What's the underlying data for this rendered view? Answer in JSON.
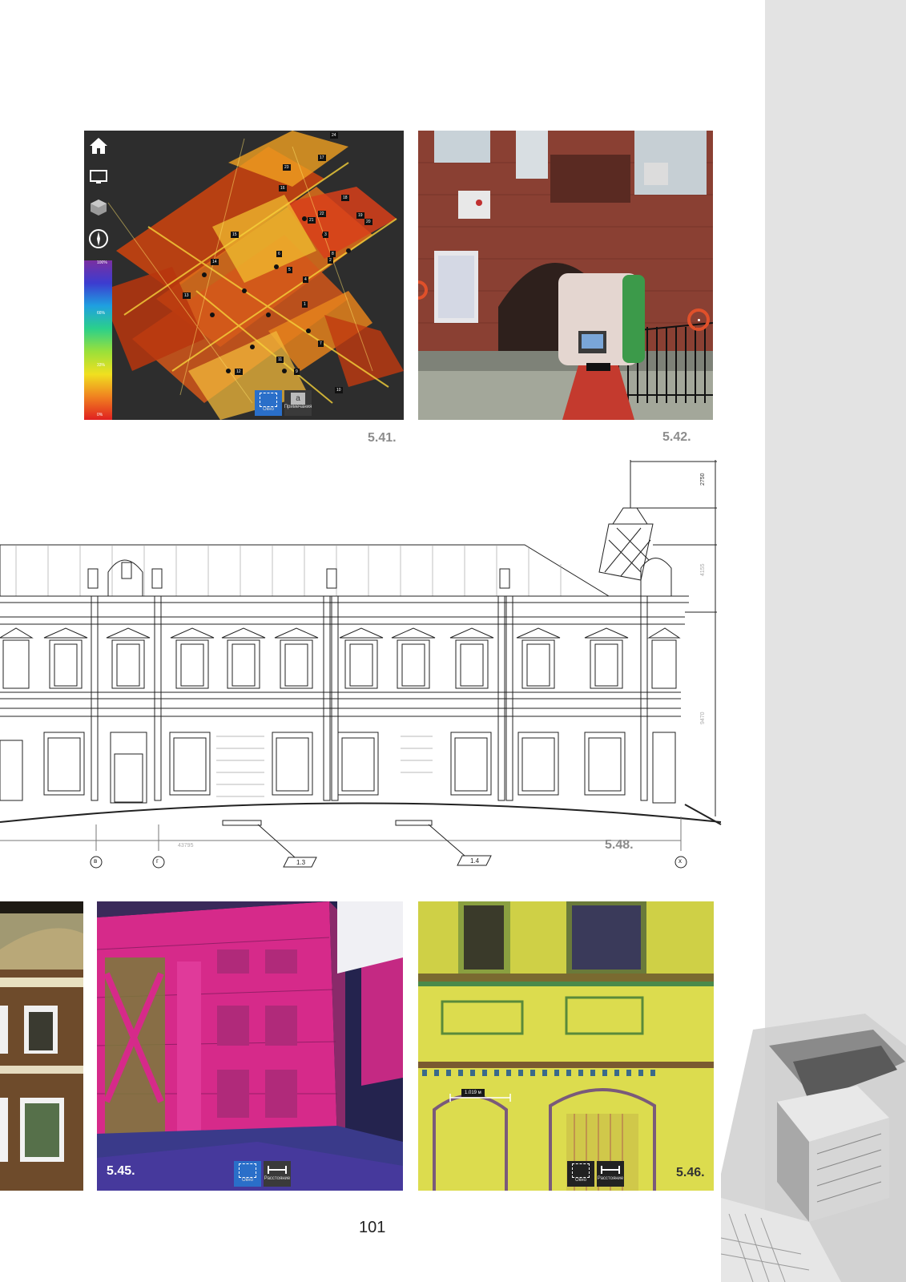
{
  "page_number": "101",
  "figures": {
    "f541": {
      "caption": "5.41.",
      "legend_labels": [
        "100%",
        "66%",
        "33%",
        "0%"
      ],
      "buttons": [
        {
          "label": "Окно",
          "icon": "select-box-icon"
        },
        {
          "label": "Примечания",
          "icon": "note-icon"
        }
      ],
      "side_tools": [
        "home-icon",
        "monitor-icon",
        "cube-icon",
        "compass-icon"
      ],
      "scan_station_tags": [
        "24",
        "17",
        "23",
        "16",
        "18",
        "22",
        "21",
        "19",
        "20",
        "15",
        "6",
        "3",
        "14",
        "5",
        "13",
        "4",
        "8",
        "7",
        "11",
        "12",
        "9",
        "10",
        "1",
        "2"
      ]
    },
    "f542": {
      "caption": "5.42.",
      "target_markers": [
        "target-left",
        "target-right"
      ]
    },
    "f548": {
      "caption": "5.48.",
      "dimensions": [
        "2750",
        "4155",
        "9470",
        "43795"
      ],
      "axis_marks": [
        "в",
        "г",
        "х"
      ],
      "callouts": [
        "1.3",
        "1.4"
      ]
    },
    "f545": {
      "caption": "5.45.",
      "buttons": [
        {
          "label": "Окно",
          "icon": "select-box-icon"
        },
        {
          "label": "Расстояние",
          "icon": "distance-icon"
        }
      ]
    },
    "f546": {
      "caption": "5.46.",
      "measurement": "1.019 м",
      "buttons": [
        {
          "label": "Окно",
          "icon": "select-box-icon"
        },
        {
          "label": "Расстояние",
          "icon": "distance-icon"
        }
      ]
    }
  }
}
